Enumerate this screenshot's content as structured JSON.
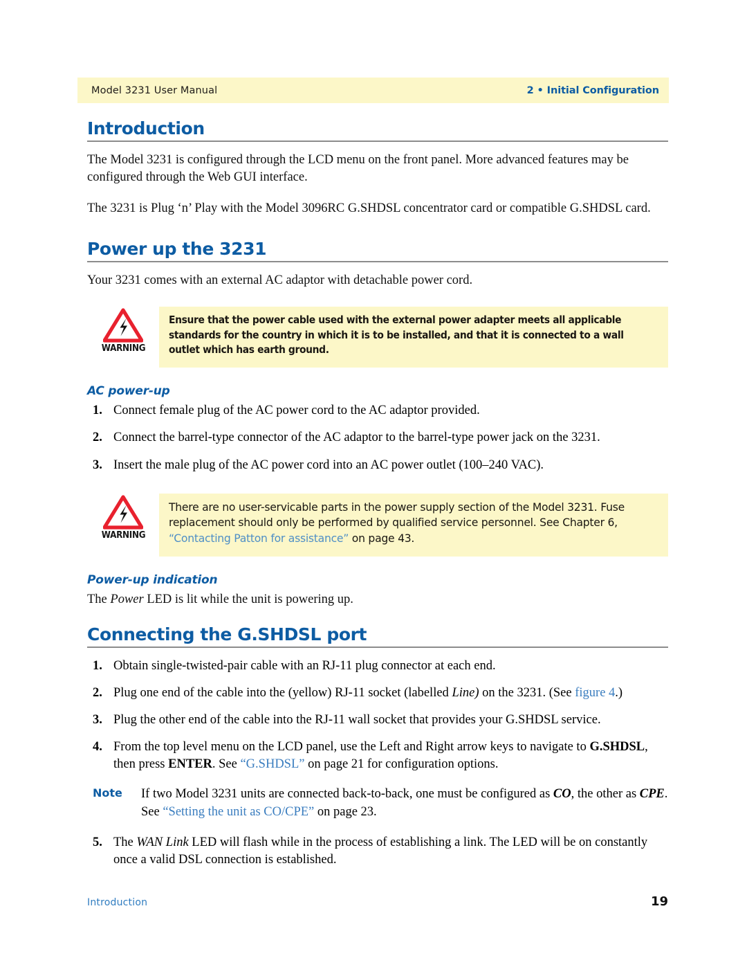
{
  "header": {
    "left": "Model 3231 User Manual",
    "right": "2 • Initial Configuration",
    "band_color": "#fcf7c8",
    "accent_color": "#0d5ca3"
  },
  "sections": {
    "introduction": {
      "heading": "Introduction",
      "paragraph_1": "The Model 3231 is configured through the LCD menu on the front panel. More advanced features may be configured through the Web GUI interface.",
      "paragraph_2": "The 3231 is Plug ‘n’ Play with the Model 3096RC G.SHDSL concentrator card or compatible G.SHDSL card."
    },
    "power_up": {
      "heading": "Power up the 3231",
      "paragraph_1": "Your 3231 comes with an external AC adaptor with detachable power cord.",
      "warning_1": {
        "icon_label": "WARNING",
        "text": "Ensure that the power cable used with the external power adapter meets all applicable standards for the country in which it is to be installed, and that it is connected to a wall outlet which has earth ground."
      },
      "ac_power_up": {
        "subheading": "AC power-up",
        "items": [
          {
            "num": "1.",
            "text": "Connect female plug of the AC power cord to the AC adaptor provided."
          },
          {
            "num": "2.",
            "text": "Connect the barrel-type connector of the AC adaptor to the barrel-type power jack on the 3231."
          },
          {
            "num": "3.",
            "text": "Insert the male plug of the AC power cord into an AC power outlet (100–240 VAC)."
          }
        ]
      },
      "warning_2": {
        "icon_label": "WARNING",
        "text_before": "There are no user-servicable parts in the power supply section of the Model 3231. Fuse replacement should only be performed by qualified service personnel. See Chapter 6, ",
        "link_text": "“Contacting Patton for assistance”",
        "text_after": " on page 43."
      },
      "power_up_indication": {
        "subheading": "Power-up indication",
        "text_before": "The ",
        "italic_word": "Power",
        "text_after": " LED is lit while the unit is powering up."
      }
    },
    "connecting": {
      "heading": "Connecting the G.SHDSL port",
      "item_1": "Obtain single-twisted-pair cable with an RJ-11 plug connector at each end.",
      "item_1_num": "1.",
      "item_2_num": "2.",
      "item_2_a": "Plug one end of the cable into the (yellow) RJ-11 socket (labelled ",
      "item_2_italic": "Line)",
      "item_2_b": " on the 3231. (See ",
      "item_2_link": "figure 4",
      "item_2_c": ".)",
      "item_3_num": "3.",
      "item_3": "Plug the other end of the cable into the RJ-11 wall socket that provides your G.SHDSL service.",
      "item_4_num": "4.",
      "item_4_a": "From the top level menu on the LCD panel, use the Left and Right arrow keys to navigate to ",
      "item_4_bold_1": "G.SHDSL",
      "item_4_b": ", then press ",
      "item_4_bold_2": "ENTER",
      "item_4_c": ". See ",
      "item_4_link": "“G.SHDSL”",
      "item_4_d": " on page 21 for configuration options.",
      "note": {
        "label": "Note",
        "text_a": "If two Model 3231 units are connected back-to-back, one must be configured as ",
        "bold_italic_1": "CO",
        "text_b": ", the other as ",
        "bold_italic_2": "CPE",
        "text_c": ". See ",
        "link": "“Setting the unit as CO/CPE”",
        "text_d": " on page 23."
      },
      "item_5_num": "5.",
      "item_5_a": "The ",
      "item_5_italic": "WAN Link",
      "item_5_b": " LED will flash while in the process of establishing a link. The LED will be on constantly once a valid DSL connection is established."
    }
  },
  "footer": {
    "left": "Introduction",
    "page_number": "19"
  }
}
